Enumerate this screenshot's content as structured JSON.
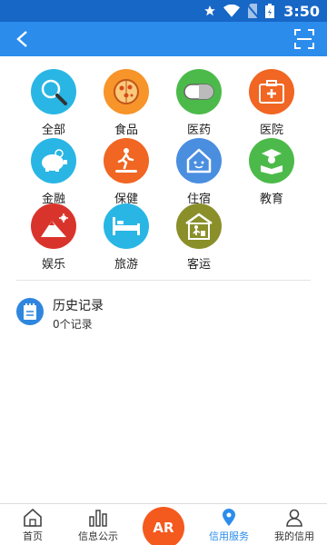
{
  "status_bar": {
    "time": "3:50"
  },
  "categories": [
    {
      "label": "全部",
      "icon": "magnifier-icon",
      "color": "#29b6e4"
    },
    {
      "label": "食品",
      "icon": "pizza-icon",
      "color": "#f7942a"
    },
    {
      "label": "医药",
      "icon": "pill-icon",
      "color": "#4cba4a"
    },
    {
      "label": "医院",
      "icon": "medical-kit-icon",
      "color": "#f06622"
    },
    {
      "label": "金融",
      "icon": "piggy-bank-icon",
      "color": "#29b6e4"
    },
    {
      "label": "保健",
      "icon": "treadmill-icon",
      "color": "#f06622"
    },
    {
      "label": "住宿",
      "icon": "house-icon",
      "color": "#4a8ee0"
    },
    {
      "label": "教育",
      "icon": "student-book-icon",
      "color": "#4cba4a"
    },
    {
      "label": "娱乐",
      "icon": "ski-slope-icon",
      "color": "#d9342b"
    },
    {
      "label": "旅游",
      "icon": "bed-icon",
      "color": "#29b6e4"
    },
    {
      "label": "客运",
      "icon": "station-icon",
      "color": "#8a8f2a"
    }
  ],
  "history": {
    "title": "历史记录",
    "count": "0个记录"
  },
  "tabbar": {
    "tabs": [
      {
        "label": "首页",
        "icon": "home-icon"
      },
      {
        "label": "信息公示",
        "icon": "bar-chart-icon"
      },
      {
        "label": "信用服务",
        "icon": "location-pin-icon",
        "active": true
      },
      {
        "label": "我的信用",
        "icon": "user-icon"
      }
    ],
    "ar_label": "AR",
    "accent": "#2b8cec",
    "ar_color": "#f4591e"
  }
}
